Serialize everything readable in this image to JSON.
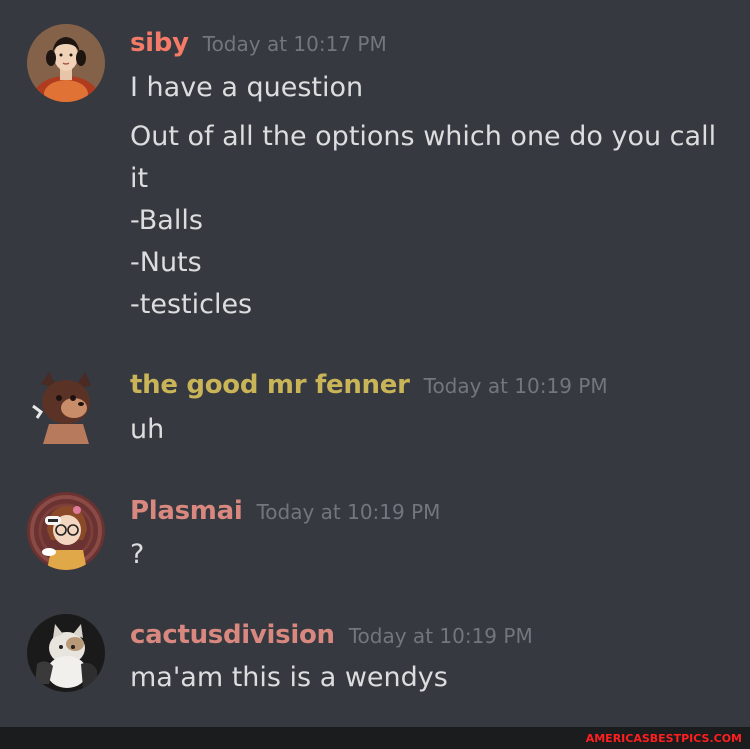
{
  "colors": {
    "background": "#36393f",
    "text": "#dcddde",
    "timestamp": "#72767d",
    "siby": "#f47b67",
    "fenner": "#c9b458",
    "plasmai": "#d8887e",
    "cactus": "#d8887e"
  },
  "messages": [
    {
      "username": "siby",
      "timestamp": "Today at 10:17 PM",
      "avatar": "victorian-portrait-avatar",
      "lines": [
        "I have a question"
      ],
      "paragraph": "Out of all the options which one do you call it",
      "list": [
        "-Balls",
        "-Nuts",
        "-testicles"
      ]
    },
    {
      "username": "the good mr fenner",
      "timestamp": "Today at 10:19 PM",
      "avatar": "furry-character-avatar",
      "lines": [
        "uh"
      ]
    },
    {
      "username": "Plasmai",
      "timestamp": "Today at 10:19 PM",
      "avatar": "cartoon-glasses-girl-avatar",
      "lines": [
        "?"
      ]
    },
    {
      "username": "cactusdivision",
      "timestamp": "Today at 10:19 PM",
      "avatar": "cat-photo-avatar",
      "lines": [
        "ma'am this is a wendys"
      ]
    }
  ],
  "watermark": "AMERICASBESTPICS.COM"
}
